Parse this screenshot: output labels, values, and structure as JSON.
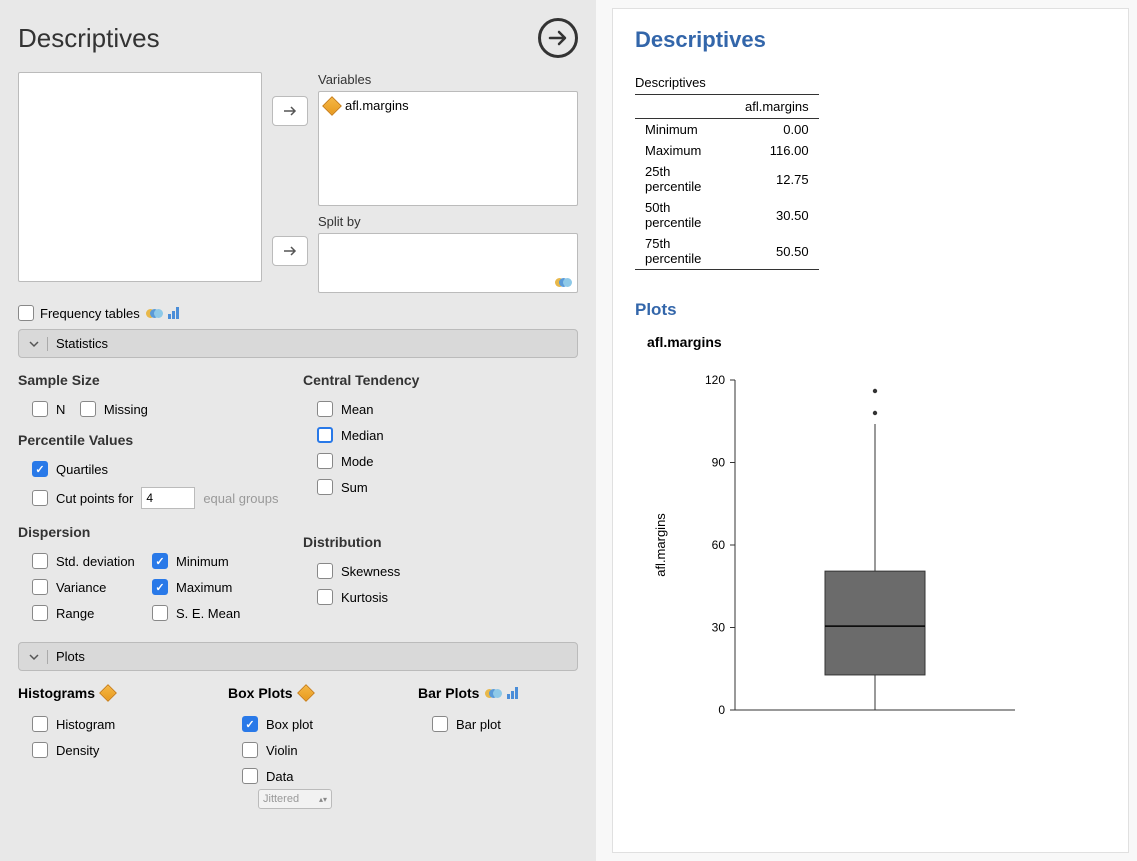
{
  "header": {
    "title": "Descriptives"
  },
  "variables": {
    "label": "Variables",
    "items": [
      "afl.margins"
    ],
    "split_label": "Split by"
  },
  "freq_tables_label": "Frequency tables",
  "sections": {
    "statistics": "Statistics",
    "plots": "Plots"
  },
  "stats": {
    "sample_size": {
      "title": "Sample Size",
      "n": "N",
      "missing": "Missing"
    },
    "percentile": {
      "title": "Percentile Values",
      "quartiles": "Quartiles",
      "cut_points": "Cut points for",
      "cut_value": "4",
      "equal_groups": "equal groups"
    },
    "dispersion": {
      "title": "Dispersion",
      "std": "Std. deviation",
      "variance": "Variance",
      "range": "Range",
      "min": "Minimum",
      "max": "Maximum",
      "se": "S. E. Mean"
    },
    "central": {
      "title": "Central Tendency",
      "mean": "Mean",
      "median": "Median",
      "mode": "Mode",
      "sum": "Sum"
    },
    "distribution": {
      "title": "Distribution",
      "skewness": "Skewness",
      "kurtosis": "Kurtosis"
    }
  },
  "plots_cfg": {
    "hist_title": "Histograms",
    "box_title": "Box Plots",
    "bar_title": "Bar Plots",
    "histogram": "Histogram",
    "density": "Density",
    "boxplot": "Box plot",
    "violin": "Violin",
    "data": "Data",
    "jitter": "Jittered",
    "barplot": "Bar plot"
  },
  "output": {
    "title": "Descriptives",
    "plots_title": "Plots",
    "table": {
      "title": "Descriptives",
      "col": "afl.margins",
      "rows": [
        {
          "label": "Minimum",
          "value": "0.00"
        },
        {
          "label": "Maximum",
          "value": "116.00"
        },
        {
          "label": "25th percentile",
          "value": "12.75"
        },
        {
          "label": "50th percentile",
          "value": "30.50"
        },
        {
          "label": "75th percentile",
          "value": "50.50"
        }
      ]
    },
    "plot_var": "afl.margins"
  },
  "chart_data": {
    "type": "boxplot",
    "ylabel": "afl.margins",
    "ylim": [
      0,
      120
    ],
    "yticks": [
      0,
      30,
      60,
      90,
      120
    ],
    "series": [
      {
        "name": "afl.margins",
        "min": 0,
        "q1": 12.75,
        "median": 30.5,
        "q3": 50.5,
        "whisker_high": 104,
        "outliers": [
          108,
          116
        ]
      }
    ]
  }
}
